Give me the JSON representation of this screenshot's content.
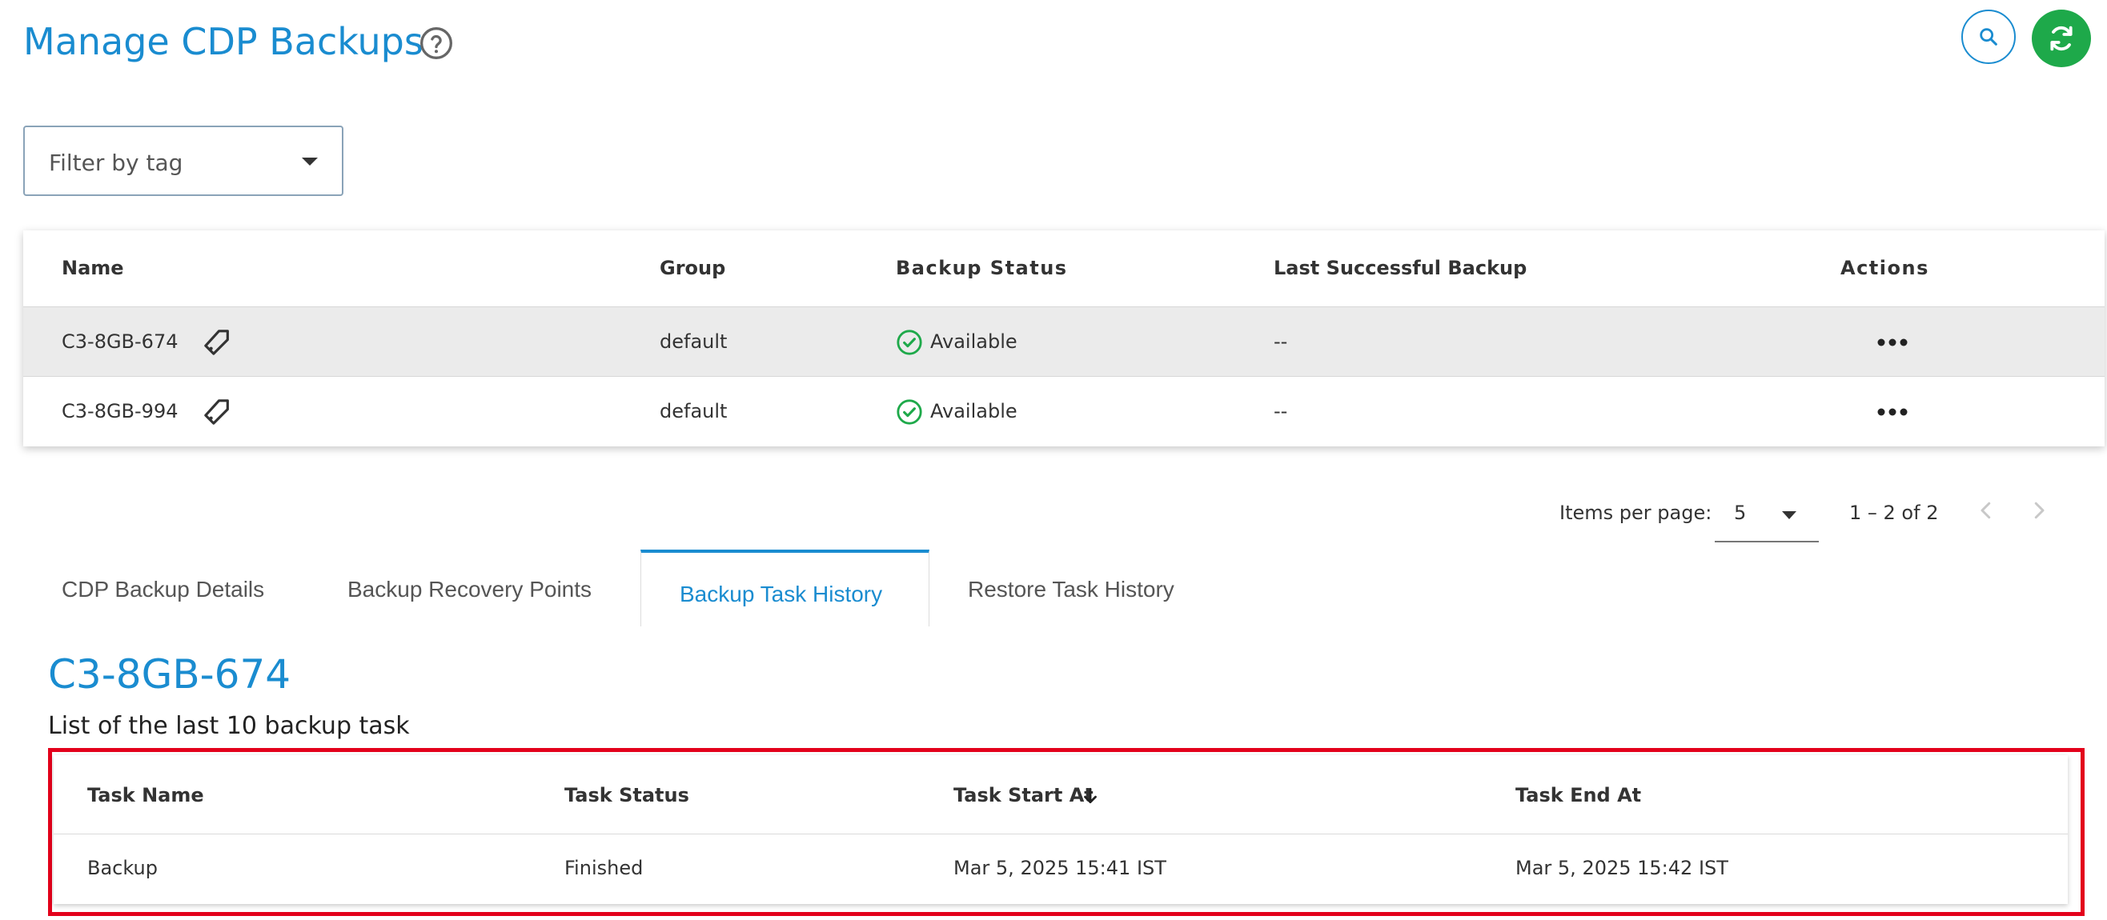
{
  "header": {
    "title": "Manage CDP Backups",
    "help_icon": "help-circle-icon",
    "search_icon": "search-icon",
    "refresh_icon": "refresh-icon"
  },
  "filter": {
    "label": "Filter by tag"
  },
  "backups_table": {
    "columns": [
      "Name",
      "Group",
      "Backup Status",
      "Last Successful Backup",
      "Actions"
    ],
    "rows": [
      {
        "name": "C3-8GB-674",
        "group": "default",
        "status": "Available",
        "last_backup": "--",
        "selected": true
      },
      {
        "name": "C3-8GB-994",
        "group": "default",
        "status": "Available",
        "last_backup": "--",
        "selected": false
      }
    ]
  },
  "paginator": {
    "items_per_page_label": "Items per page:",
    "page_size": "5",
    "range": "1 – 2 of 2"
  },
  "tabs": [
    {
      "label": "CDP Backup Details",
      "active": false
    },
    {
      "label": "Backup Recovery Points",
      "active": false
    },
    {
      "label": "Backup Task History",
      "active": true
    },
    {
      "label": "Restore Task History",
      "active": false
    }
  ],
  "detail": {
    "title": "C3-8GB-674",
    "subtitle": "List of the last 10 backup task"
  },
  "task_table": {
    "columns": [
      "Task Name",
      "Task Status",
      "Task Start At",
      "Task End At"
    ],
    "sort_icon": "arrow-down-icon",
    "rows": [
      {
        "name": "Backup",
        "status": "Finished",
        "start": "Mar 5, 2025 15:41 IST",
        "end": "Mar 5, 2025 15:42 IST"
      }
    ]
  },
  "colors": {
    "accent": "#1a8cd0",
    "success": "#1ea94a",
    "highlight": "#e3001b"
  }
}
